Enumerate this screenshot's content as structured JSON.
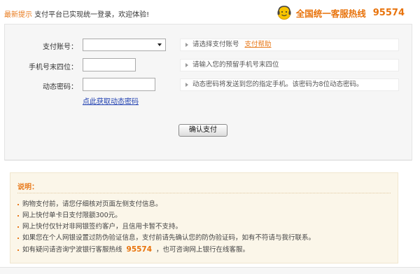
{
  "notice": {
    "tag": "最新提示",
    "message": "支付平台已实现统一登录，欢迎体验!"
  },
  "hotline": {
    "label": "全国统一客服热线",
    "number": "95574",
    "color": "#e8730c"
  },
  "form": {
    "account": {
      "label": "支付账号：",
      "value": "",
      "hint": "请选择支付账号",
      "help_link": "支付帮助"
    },
    "phone": {
      "label": "手机号末四位：",
      "value": "",
      "hint": "请输入您的预留手机号末四位"
    },
    "code": {
      "label": "动态密码：",
      "value": "",
      "hint": "动态密码将发送到您的指定手机。该密码为8位动态密码。"
    },
    "get_code_link": "点此获取动态密码",
    "confirm_button": "确认支付"
  },
  "info": {
    "title": "说明：",
    "items": [
      "购物支付前，请您仔细核对页面左侧支付信息。",
      "网上快付单卡日支付限额300元。",
      "网上快付仅针对非网银签约客户，且信用卡暂不支持。",
      "如果您在个人网银设置过防伪验证信息，支付前请先确认您的防伪验证码，如有不符请与我行联系。"
    ],
    "last_item": {
      "prefix": "如有疑问请咨询宁波银行客服热线",
      "number": "95574",
      "suffix": "，也可咨询网上银行在线客服。"
    }
  },
  "colors": {
    "accent": "#e87a1c",
    "link": "#1f3fb0",
    "panel_bg": "#f6f6f6",
    "info_bg": "#fbf6e9"
  }
}
